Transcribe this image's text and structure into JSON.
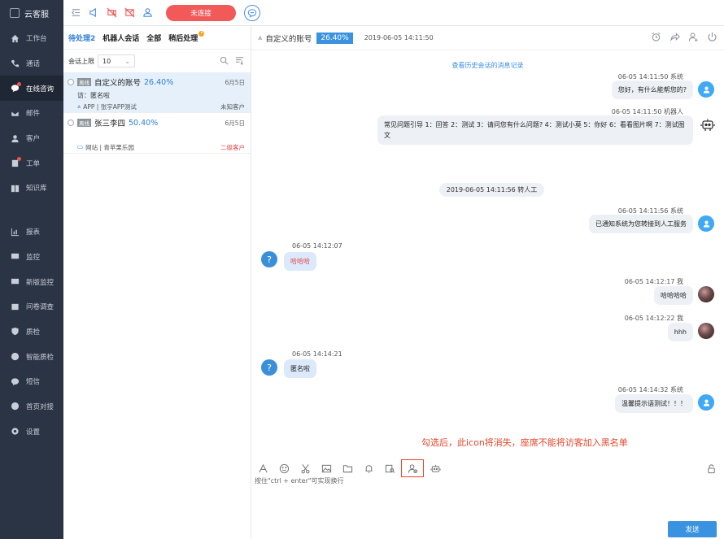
{
  "brand": {
    "title": "云客服"
  },
  "sidebar": {
    "items": [
      {
        "label": "工作台",
        "icon": "home-icon"
      },
      {
        "label": "通话",
        "icon": "phone-icon"
      },
      {
        "label": "在线咨询",
        "icon": "chat-icon",
        "active": true,
        "dot": true
      },
      {
        "label": "邮件",
        "icon": "mail-icon"
      },
      {
        "label": "客户",
        "icon": "user-icon"
      },
      {
        "label": "工单",
        "icon": "ticket-icon",
        "dot": true
      },
      {
        "label": "知识库",
        "icon": "book-icon"
      },
      {
        "label": "报表",
        "icon": "bar-chart-icon"
      },
      {
        "label": "监控",
        "icon": "monitor-icon"
      },
      {
        "label": "新版监控",
        "icon": "pulse-icon"
      },
      {
        "label": "问卷调查",
        "icon": "survey-icon"
      },
      {
        "label": "质检",
        "icon": "shield-icon"
      },
      {
        "label": "智能质检",
        "icon": "smart-check-icon"
      },
      {
        "label": "短信",
        "icon": "sms-icon"
      },
      {
        "label": "首页对接",
        "icon": "link-icon"
      },
      {
        "label": "设置",
        "icon": "gear-icon"
      }
    ]
  },
  "topbar": {
    "connect_label": "未连接"
  },
  "list": {
    "tabs": [
      {
        "label": "待处理2",
        "active": true
      },
      {
        "label": "机器人会话"
      },
      {
        "label": "全部"
      },
      {
        "label": "稍后处理",
        "badge": true
      }
    ],
    "filter_label": "会话上限",
    "filter_value": "10",
    "conversations": [
      {
        "tag": "离线",
        "name": "自定义的账号",
        "pct": "26.40%",
        "date": "6月5日",
        "line2": "访：匿名啦",
        "source": "APP | 张宇APP测试",
        "right": "未知客户",
        "right_red": false,
        "selected": true
      },
      {
        "tag": "离线",
        "name": "张三李四",
        "pct": "50.40%",
        "date": "6月5日",
        "line2": "",
        "source": "网站 | 青苹果乐园",
        "right": "二级客户",
        "right_red": true,
        "selected": false
      }
    ]
  },
  "chat": {
    "title": "自定义的账号",
    "pct": "26.40%",
    "time": "2019-06-05 14:11:50",
    "history_link": "查看历史会话的消息记录",
    "messages": [
      {
        "meta": "06-05 14:11:50 系统",
        "text": "您好，有什么能帮您的?"
      },
      {
        "meta": "06-05 14:11:50 机器人",
        "text": "常见问题引导 1：回答 2：测试 3：请问您有什么问题? 4：测试小莫 5：你好 6：看看图片啊 7：测试图文"
      },
      {
        "center": "2019-06-05 14:11:56 转人工"
      },
      {
        "meta": "06-05 14:11:56 系统",
        "text": "已通知系统为您转接到人工服务"
      },
      {
        "meta": "06-05 14:12:07",
        "text": "哈哈哈"
      },
      {
        "meta": "06-05 14:12:17 我",
        "text": "哈哈哈哈"
      },
      {
        "meta": "06-05 14:12:22 我",
        "text": "hhh"
      },
      {
        "meta": "06-05 14:14:21",
        "text": "匿名啦"
      },
      {
        "meta": "06-05 14:14:32 系统",
        "text": "温馨提示语测试！！！"
      }
    ],
    "annotation": "勾选后，此icon将消失，座席不能将访客加入黑名单",
    "hint": "按住\"ctrl + enter\"可实现换行",
    "send_label": "发送"
  }
}
